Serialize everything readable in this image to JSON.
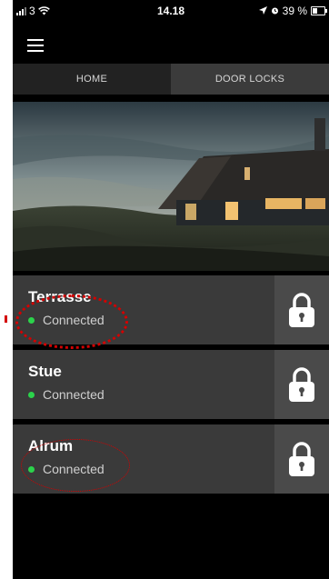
{
  "status_bar": {
    "carrier": "3",
    "time": "14.18",
    "battery": "39 %",
    "battery_level": 0.39
  },
  "tabs": [
    {
      "label": "HOME",
      "active": true
    },
    {
      "label": "DOOR LOCKS",
      "active": false
    }
  ],
  "locks": [
    {
      "name": "Terrasse",
      "status": "Connected"
    },
    {
      "name": "Stue",
      "status": "Connected"
    },
    {
      "name": "Alrum",
      "status": "Connected"
    }
  ],
  "colors": {
    "background": "#000000",
    "card": "#3a3a3a",
    "lock_button": "#4a4a4a",
    "connected_dot": "#2bd34b",
    "annotation": "#d40000"
  },
  "icons": {
    "menu": "hamburger-menu-icon",
    "lock": "padlock-icon",
    "wifi": "wifi-icon",
    "location": "location-arrow-icon",
    "alarm": "alarm-clock-icon"
  }
}
